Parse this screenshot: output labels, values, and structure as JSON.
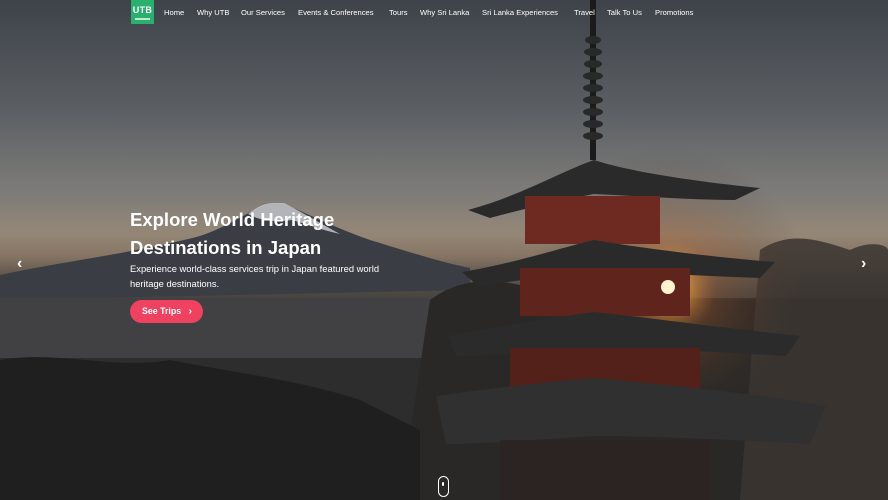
{
  "logo": {
    "text": "UTB"
  },
  "nav": {
    "items": [
      {
        "label": "Home"
      },
      {
        "label": "Why UTB"
      },
      {
        "label": "Our Services"
      },
      {
        "label": "Events & Conferences"
      },
      {
        "label": "Tours"
      },
      {
        "label": "Why Sri Lanka"
      },
      {
        "label": "Sri Lanka Experiences"
      },
      {
        "label": "Travel"
      },
      {
        "label": "Talk To Us"
      },
      {
        "label": "Promotions"
      }
    ]
  },
  "hero": {
    "headline_line1": "Explore World Heritage",
    "headline_line2": "Destinations in Japan",
    "subtext_line1": "Experience world-class services trip in Japan featured world",
    "subtext_line2": "heritage destinations.",
    "cta_label": "See Trips",
    "cta_icon": "chevron-right-icon",
    "prev_icon": "chevron-left-icon",
    "next_icon": "chevron-right-icon",
    "scroll_icon": "mouse-scroll-icon"
  },
  "colors": {
    "logo_bg": "#29b06e",
    "cta_bg": "#ef4160",
    "text": "#ffffff"
  }
}
